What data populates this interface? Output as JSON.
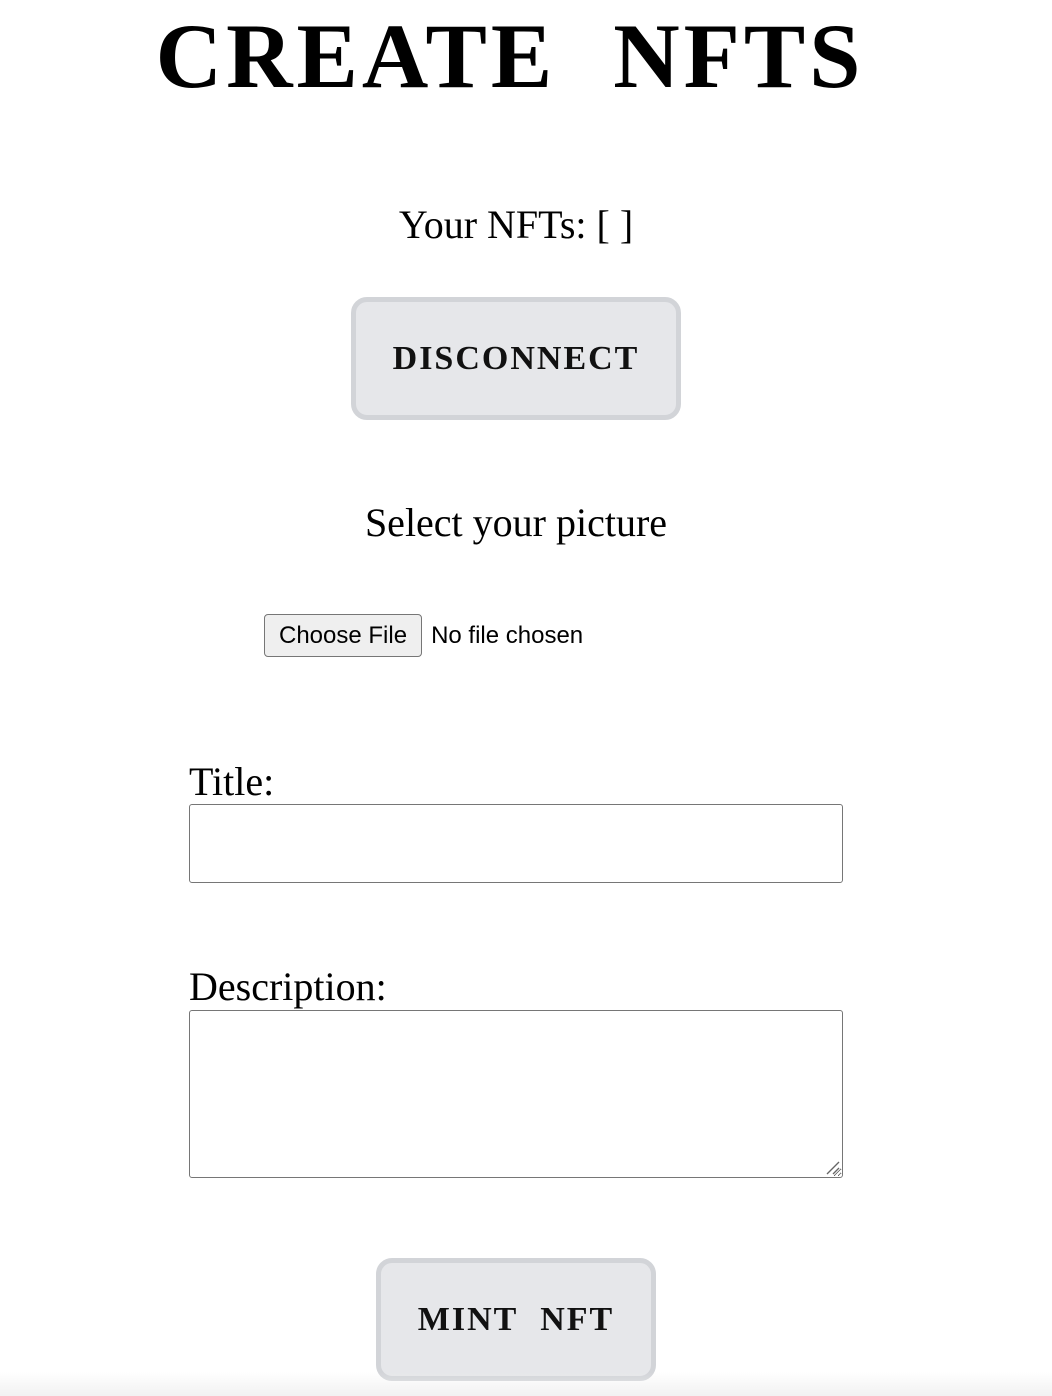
{
  "header": {
    "title": "CREATE NFTS"
  },
  "wallet": {
    "nfts_text": "Your NFTs: [ ]",
    "disconnect_label": "DISCONNECT"
  },
  "upload": {
    "label": "Select your picture",
    "choose_file_label": "Choose File",
    "file_status": "No file chosen"
  },
  "form": {
    "title_label": "Title:",
    "title_value": "",
    "description_label": "Description:",
    "description_value": "",
    "mint_label": "MINT NFT"
  },
  "icons": {
    "resize": "textarea-resize-icon"
  }
}
